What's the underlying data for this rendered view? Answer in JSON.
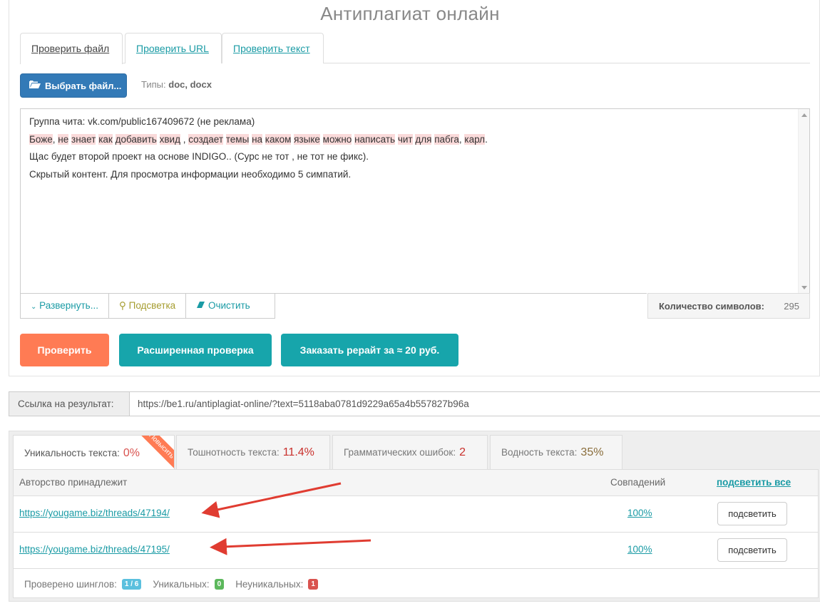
{
  "page_title": "Антиплагиат онлайн",
  "tabs": [
    {
      "label": "Проверить файл",
      "active": true
    },
    {
      "label": "Проверить URL"
    },
    {
      "label": "Проверить текст"
    }
  ],
  "upload": {
    "button_label": "Выбрать файл...",
    "types_label": "Типы:",
    "types_value": "doc, docx"
  },
  "editor": {
    "line1": "Группа чита: vk.com/public167409672 (не реклама)",
    "line2_words": [
      "Боже",
      ",",
      " ",
      "не",
      " ",
      "знает",
      " ",
      "как",
      " ",
      "добавить",
      " ",
      "хвид",
      " , ",
      "создает",
      " ",
      "темы",
      " ",
      "на",
      " ",
      "каком",
      " ",
      "языке",
      " ",
      "можно",
      " ",
      "написать",
      " ",
      "чит",
      " ",
      "для",
      " ",
      "пабга",
      ", ",
      "карл",
      "."
    ],
    "line3": "Щас будет второй проект на основе INDIGO.. (Сурс не тот , не тот не фикс).",
    "line4": "Скрытый контент. Для просмотра информации необходимо 5 симпатий."
  },
  "tools": {
    "expand": "Развернуть...",
    "highlight": "Подсветка",
    "clear": "Очистить"
  },
  "counter": {
    "label": "Количество символов:",
    "value": "295"
  },
  "actions": {
    "check": "Проверить",
    "advanced": "Расширенная проверка",
    "order": "Заказать рерайт за ≈ 20 руб."
  },
  "result_link": {
    "label": "Ссылка на результат:",
    "value": "https://be1.ru/antiplagiat-online/?text=5118aba0781d9229a65a4b557827b96a"
  },
  "result_tabs": [
    {
      "label": "Уникальность текста:",
      "value": "0%",
      "ribbon": "Повысить",
      "color": "#d9534f"
    },
    {
      "label": "Тошнотность текста:",
      "value": "11.4%",
      "color": "#c9302c"
    },
    {
      "label": "Грамматических ошибок:",
      "value": "2",
      "color": "#c9302c"
    },
    {
      "label": "Водность текста:",
      "value": "35%",
      "color": "#8a6d3b"
    }
  ],
  "table": {
    "col_author": "Авторство принадлежит",
    "col_matches": "Совпадений",
    "highlight_all": "подсветить все",
    "rows": [
      {
        "url": "https://yougame.biz/threads/47194/",
        "match": "100%",
        "button": "подсветить"
      },
      {
        "url": "https://yougame.biz/threads/47195/",
        "match": "100%",
        "button": "подсветить"
      }
    ]
  },
  "footer": {
    "shingles_label": "Проверено шинглов:",
    "shingles_value": "1 / 6",
    "unique_label": "Уникальных:",
    "unique_value": "0",
    "nonunique_label": "Неуникальных:",
    "nonunique_value": "1"
  },
  "colors": {
    "accent_teal": "#17a5ab",
    "accent_orange": "#ff7b54",
    "primary_blue": "#337ab7",
    "highlight_bg": "#fadada",
    "arrow_red": "#e03c31"
  }
}
